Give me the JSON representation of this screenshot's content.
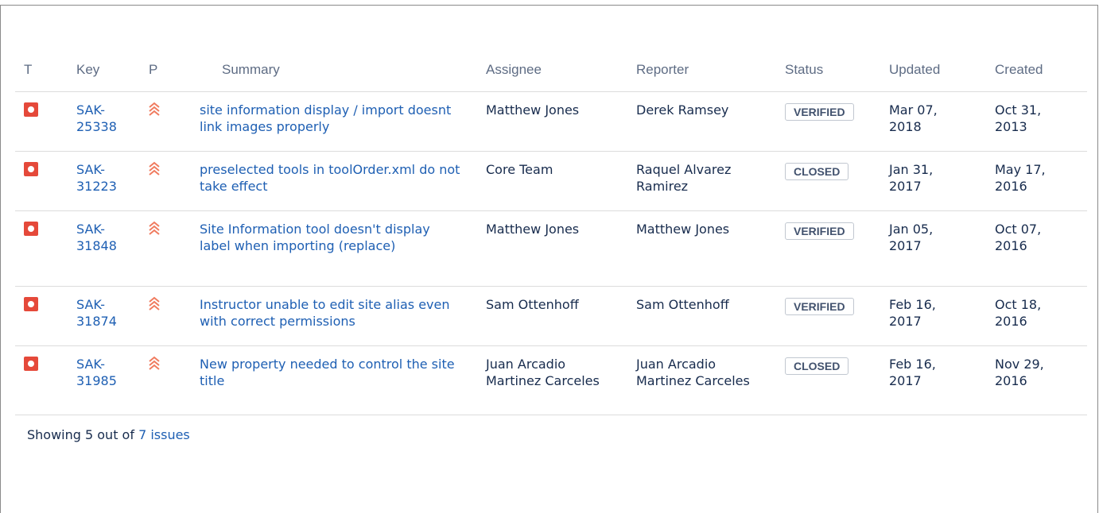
{
  "columns": {
    "type": "T",
    "key": "Key",
    "priority": "P",
    "summary": "Summary",
    "assignee": "Assignee",
    "reporter": "Reporter",
    "status": "Status",
    "updated": "Updated",
    "created": "Created"
  },
  "issues": [
    {
      "key_line1": "SAK-",
      "key_line2": "25338",
      "summary": "site information display / import doesnt link images properly",
      "assignee": "Matthew Jones",
      "reporter": "Derek Ramsey",
      "status": "VERIFIED",
      "updated": "Mar 07, 2018",
      "created": "Oct 31, 2013"
    },
    {
      "key_line1": "SAK-",
      "key_line2": "31223",
      "summary": "preselected tools in toolOrder.xml do not take effect",
      "assignee": "Core Team",
      "reporter": "Raquel Alvarez Ramirez",
      "status": "CLOSED",
      "updated": "Jan 31, 2017",
      "created": "May 17, 2016"
    },
    {
      "key_line1": "SAK-",
      "key_line2": "31848",
      "summary": "Site Information tool doesn't display label when importing (replace)",
      "assignee": "Matthew Jones",
      "reporter": "Matthew Jones",
      "status": "VERIFIED",
      "updated": "Jan 05, 2017",
      "created": "Oct 07, 2016"
    },
    {
      "key_line1": "SAK-",
      "key_line2": "31874",
      "summary": "Instructor unable to edit site alias even with correct permissions",
      "assignee": "Sam Ottenhoff",
      "reporter": "Sam Ottenhoff",
      "status": "VERIFIED",
      "updated": "Feb 16, 2017",
      "created": "Oct 18, 2016"
    },
    {
      "key_line1": "SAK-",
      "key_line2": "31985",
      "summary": "New property needed to control the site title",
      "assignee": "Juan Arcadio Martinez Carceles",
      "reporter": "Juan Arcadio Martinez Carceles",
      "status": "CLOSED",
      "updated": "Feb 16, 2017",
      "created": "Nov 29, 2016"
    }
  ],
  "icons": {
    "type": "bug-icon",
    "priority": "priority-major-icon"
  },
  "colors": {
    "link": "#1e5fb3",
    "bug": "#e5493a",
    "priority": "#f07b5f"
  },
  "footer": {
    "prefix": "Showing 5 out of ",
    "link": "7 issues"
  }
}
